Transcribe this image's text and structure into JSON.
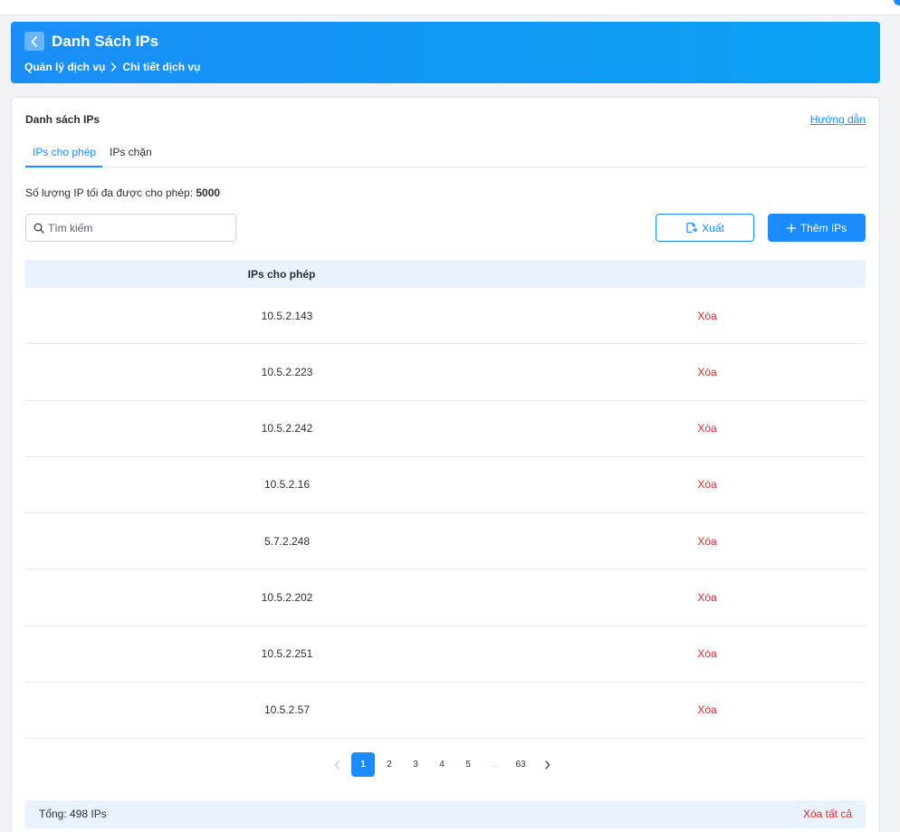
{
  "header": {
    "title": "Danh Sách IPs",
    "breadcrumb": [
      "Quản lý dịch vụ",
      "Chi tiết dịch vụ"
    ]
  },
  "card": {
    "title": "Danh sách IPs",
    "guide_link": "Hướng dẫn"
  },
  "tabs": [
    {
      "label": "IPs cho phép",
      "active": true
    },
    {
      "label": "IPs chặn",
      "active": false
    }
  ],
  "limit": {
    "label": "Số lượng IP tối đa được cho phép:",
    "value": "5000"
  },
  "search": {
    "placeholder": "Tìm kiếm",
    "value": ""
  },
  "toolbar": {
    "export_label": "Xuất",
    "add_label": "Thêm IPs"
  },
  "table": {
    "header": "IPs cho phép",
    "rows": [
      {
        "ip": "10.5.2.143",
        "action": "Xóa"
      },
      {
        "ip": "10.5.2.223",
        "action": "Xóa"
      },
      {
        "ip": "10.5.2.242",
        "action": "Xóa"
      },
      {
        "ip": "10.5.2.16",
        "action": "Xóa"
      },
      {
        "ip": "5.7.2.248",
        "action": "Xóa"
      },
      {
        "ip": "10.5.2.202",
        "action": "Xóa"
      },
      {
        "ip": "10.5.2.251",
        "action": "Xóa"
      },
      {
        "ip": "10.5.2.57",
        "action": "Xóa"
      }
    ]
  },
  "pagination": {
    "pages": [
      "1",
      "2",
      "3",
      "4",
      "5",
      "…",
      "63"
    ],
    "current": "1"
  },
  "footer": {
    "total": "Tổng: 498 IPs",
    "delete_all": "Xóa tất cả"
  },
  "colors": {
    "accent": "#1a8cff",
    "danger": "#e0252a",
    "table_header_bg": "#e8f3fd"
  }
}
